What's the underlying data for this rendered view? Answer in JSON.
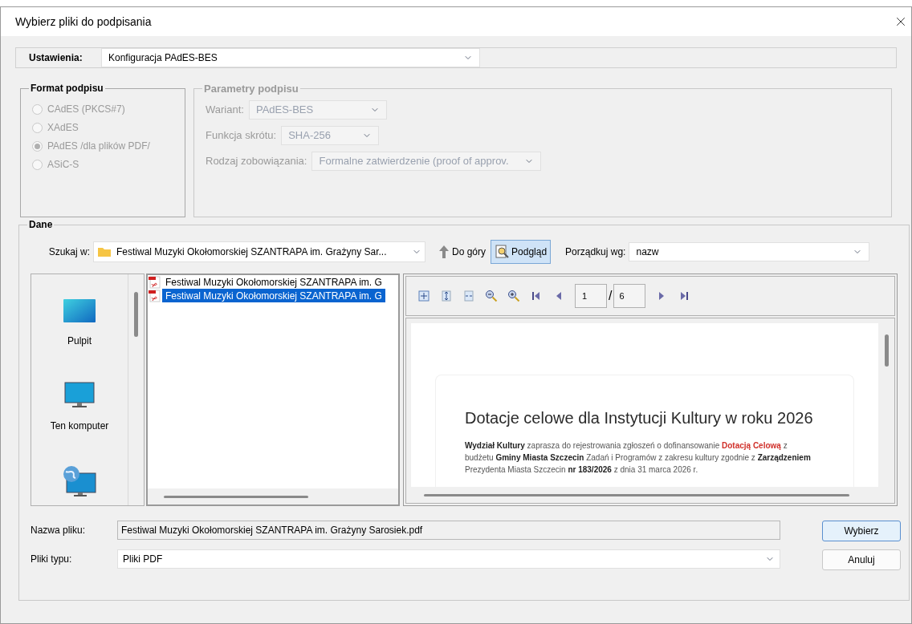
{
  "window": {
    "title": "Wybierz pliki do podpisania"
  },
  "settings": {
    "label": "Ustawienia:",
    "value": "Konfiguracja PAdES-BES"
  },
  "format_group": {
    "title": "Format podpisu",
    "disabled": true,
    "options": [
      {
        "label": "CAdES (PKCS#7)",
        "selected": false
      },
      {
        "label": "XAdES",
        "selected": false
      },
      {
        "label": "PAdES /dla plików PDF/",
        "selected": true
      },
      {
        "label": "ASiC-S",
        "selected": false
      }
    ]
  },
  "params_group": {
    "title": "Parametry podpisu",
    "disabled": true,
    "fields": [
      {
        "label": "Wariant:",
        "value": "PAdES-BES"
      },
      {
        "label": "Funkcja skrótu:",
        "value": "SHA-256"
      },
      {
        "label": "Rodzaj zobowiązania:",
        "value": "Formalne zatwierdzenie (proof of approv."
      }
    ]
  },
  "data_group": {
    "title": "Dane",
    "look_in": {
      "label": "Szukaj w:",
      "value": "Festiwal Muzyki Okołomorskiej SZANTRAPA im. Grażyny Sar..."
    },
    "up_button": {
      "label": "Do góry"
    },
    "preview_button": {
      "label": "Podgląd",
      "selected": true
    },
    "sort": {
      "label": "Porządkuj wg:",
      "value": "nazw"
    },
    "places": [
      {
        "kind": "desktop",
        "label": "Pulpit"
      },
      {
        "kind": "computer",
        "label": "Ten komputer"
      },
      {
        "kind": "network"
      }
    ],
    "files": [
      {
        "name": "Festiwal Muzyki Okołomorskiej SZANTRAPA im. G",
        "selected": false
      },
      {
        "name": "Festiwal Muzyki Okołomorskiej SZANTRAPA im. G",
        "selected": true
      }
    ],
    "preview": {
      "page": "1",
      "separator": "/",
      "pages": "6",
      "document": {
        "title": "Dotacje celowe dla Instytucji Kultury w roku 2026",
        "paragraph": [
          {
            "kind": "bold",
            "text": "Wydział Kultury"
          },
          {
            "kind": "plain",
            "text": " zaprasza do rejestrowania zgłoszeń o dofinansowanie "
          },
          {
            "kind": "highlight",
            "text": "Dotacją Celową"
          },
          {
            "kind": "plain",
            "text": " z budżetu "
          },
          {
            "kind": "bold",
            "text": "Gminy Miasta Szczecin"
          },
          {
            "kind": "plain",
            "text": " Zadań i Programów z zakresu kultury zgodnie z "
          },
          {
            "kind": "bold",
            "text": "Zarządzeniem"
          },
          {
            "kind": "plain",
            "text": " Prezydenta Miasta Szczecin "
          },
          {
            "kind": "bold",
            "text": "nr 183/2026"
          },
          {
            "kind": "plain",
            "text": " z dnia 31 marca 2026 r."
          }
        ]
      }
    },
    "file_name": {
      "label": "Nazwa pliku:",
      "value": "Festiwal Muzyki Okołomorskiej SZANTRAPA im. Grażyny Sarosiek.pdf"
    },
    "file_type": {
      "label": "Pliki typu:",
      "value": "Pliki PDF"
    },
    "buttons": [
      {
        "kind": "primary",
        "label": "Wybierz"
      },
      {
        "kind": "secondary",
        "label": "Anuluj"
      }
    ]
  }
}
